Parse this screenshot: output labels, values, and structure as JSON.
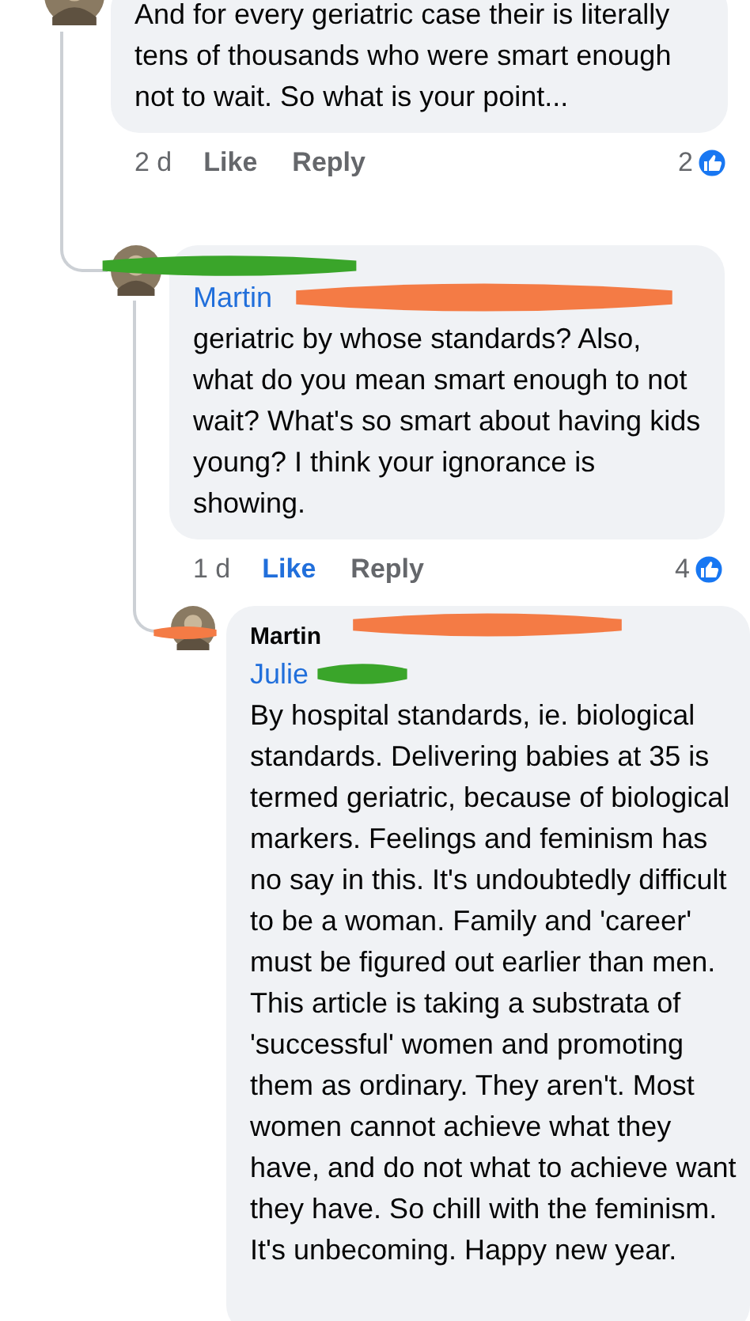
{
  "comments": [
    {
      "text": "And for every geriatric case their is literally tens of thousands who were smart enough not to wait. So what is your point...",
      "time": "2 d",
      "like": {
        "label": "Like",
        "selected": false
      },
      "reply": "Reply",
      "reactions": "2"
    },
    {
      "mention": "Martin",
      "text": "geriatric by whose standards? Also, what do you mean smart enough to not wait? What's so smart about having kids young? I think your ignorance is showing.",
      "time": "1 d",
      "like": {
        "label": "Like",
        "selected": true
      },
      "reply": "Reply",
      "reactions": "4"
    },
    {
      "author": "Martin",
      "mention": "Julie",
      "text": "By hospital standards, ie. biological standards. Delivering babies at 35 is termed geriatric, because of biological markers. Feelings and feminism has no say in this. It's undoubtedly difficult to be a woman. Family and 'career' must be figured out earlier than men. This article is taking a substrata of 'successful' women and promoting them as ordinary. They aren't. Most women cannot achieve what they have, and do not what to achieve want they have. So chill with the feminism. It's unbecoming. Happy new year."
    }
  ]
}
